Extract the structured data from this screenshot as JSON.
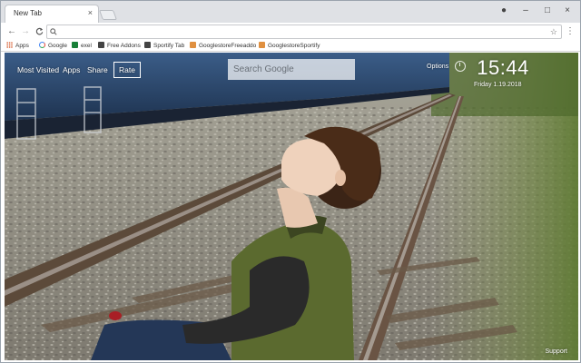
{
  "browser": {
    "tab": {
      "title": "New Tab",
      "close": "×"
    },
    "window_controls": {
      "user": "●",
      "minimize": "–",
      "maximize": "□",
      "close": "×"
    },
    "nav": {
      "back": "←",
      "forward": "→",
      "reload": "C"
    },
    "omnibox": {
      "value": "",
      "search_glyph": "Q",
      "star": "☆"
    },
    "menu_glyph": "⋮",
    "bookmarks": [
      {
        "label": "Apps",
        "icon": "apps-grid-icon",
        "color": "#d65b2e"
      },
      {
        "label": "Google",
        "icon": "google-icon",
        "color": "#ea4335"
      },
      {
        "label": "exel",
        "icon": "sheets-icon",
        "color": "#188038"
      },
      {
        "label": "Free Addons",
        "icon": "addons-icon",
        "color": "#444444"
      },
      {
        "label": "Sportify Tab",
        "icon": "sportify-icon",
        "color": "#444444"
      },
      {
        "label": "GooglestoreFreeaddo",
        "icon": "store-icon",
        "color": "#e09040"
      },
      {
        "label": "GooglestoreSportify",
        "icon": "store-icon",
        "color": "#e09040"
      }
    ]
  },
  "page": {
    "nav_links": [
      "Most Visited",
      "Apps",
      "Share",
      "Rate"
    ],
    "active_link": "Rate",
    "search_placeholder": "Search Google",
    "options_label": "Options",
    "time": "15:44",
    "date": "Friday  1.19.2018",
    "support_label": "Support"
  },
  "colors": {
    "chrome_bg": "#dfe1e5",
    "accent_train": "#2f4f78",
    "jacket": "#5a6a2e"
  }
}
